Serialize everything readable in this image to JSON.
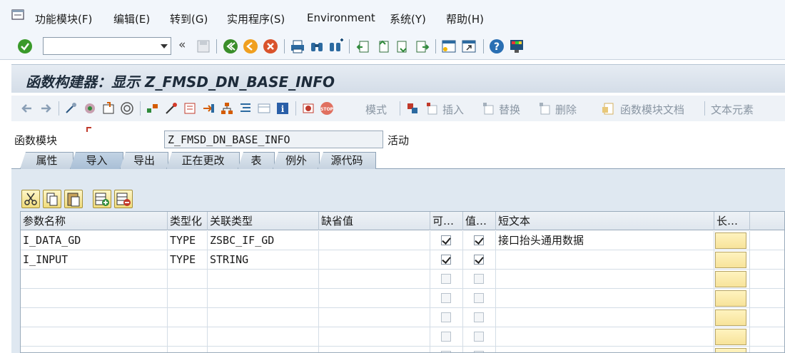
{
  "menubar": {
    "items": [
      "功能模块(F)",
      "编辑(E)",
      "转到(G)",
      "实用程序(S)",
      "Environment",
      "系统(Y)",
      "帮助(H)"
    ]
  },
  "toolbar": {
    "command_value": "",
    "icons": [
      "enter-icon",
      "back-arrows-icon",
      "save-icon",
      "back-icon",
      "exit-icon",
      "cancel-icon",
      "print-icon",
      "find-icon",
      "find-next-icon",
      "first-page-icon",
      "prev-page-icon",
      "next-page-icon",
      "last-page-icon",
      "new-session-icon",
      "shortcut-icon",
      "help-icon",
      "customize-icon"
    ]
  },
  "title": "函数构建器：显示 Z_FMSD_DN_BASE_INFO",
  "app_toolbar": {
    "pattern_label": "模式",
    "insert_label": "插入",
    "replace_label": "替换",
    "delete_label": "删除",
    "docu_label": "函数模块文档",
    "text_elements_label": "文本元素"
  },
  "function_module": {
    "label": "函数模块",
    "value": "Z_FMSD_DN_BASE_INFO",
    "status": "活动"
  },
  "tabs": [
    "属性",
    "导入",
    "导出",
    "正在更改",
    "表",
    "例外",
    "源代码"
  ],
  "active_tab": "导入",
  "table": {
    "headers": [
      "参数名称",
      "类型化",
      "关联类型",
      "缺省值",
      "可…",
      "值…",
      "短文本",
      "长…"
    ],
    "rows": [
      {
        "name": "I_DATA_GD",
        "typing": "TYPE",
        "assoc": "ZSBC_IF_GD",
        "default": "",
        "optional": true,
        "pass_value": true,
        "short_text": "接口抬头通用数据"
      },
      {
        "name": "I_INPUT",
        "typing": "TYPE",
        "assoc": "STRING",
        "default": "",
        "optional": true,
        "pass_value": true,
        "short_text": ""
      },
      {
        "name": "",
        "typing": "",
        "assoc": "",
        "default": "",
        "optional": false,
        "pass_value": false,
        "short_text": ""
      },
      {
        "name": "",
        "typing": "",
        "assoc": "",
        "default": "",
        "optional": false,
        "pass_value": false,
        "short_text": ""
      },
      {
        "name": "",
        "typing": "",
        "assoc": "",
        "default": "",
        "optional": false,
        "pass_value": false,
        "short_text": ""
      },
      {
        "name": "",
        "typing": "",
        "assoc": "",
        "default": "",
        "optional": false,
        "pass_value": false,
        "short_text": ""
      },
      {
        "name": "",
        "typing": "",
        "assoc": "",
        "default": "",
        "optional": false,
        "pass_value": false,
        "short_text": ""
      }
    ]
  },
  "colors": {
    "enter_green": "#3a9a2a",
    "title_bg": "#d4dde8",
    "panel_bg": "#dfe8f1",
    "long_text_button": "#f7e39a"
  }
}
